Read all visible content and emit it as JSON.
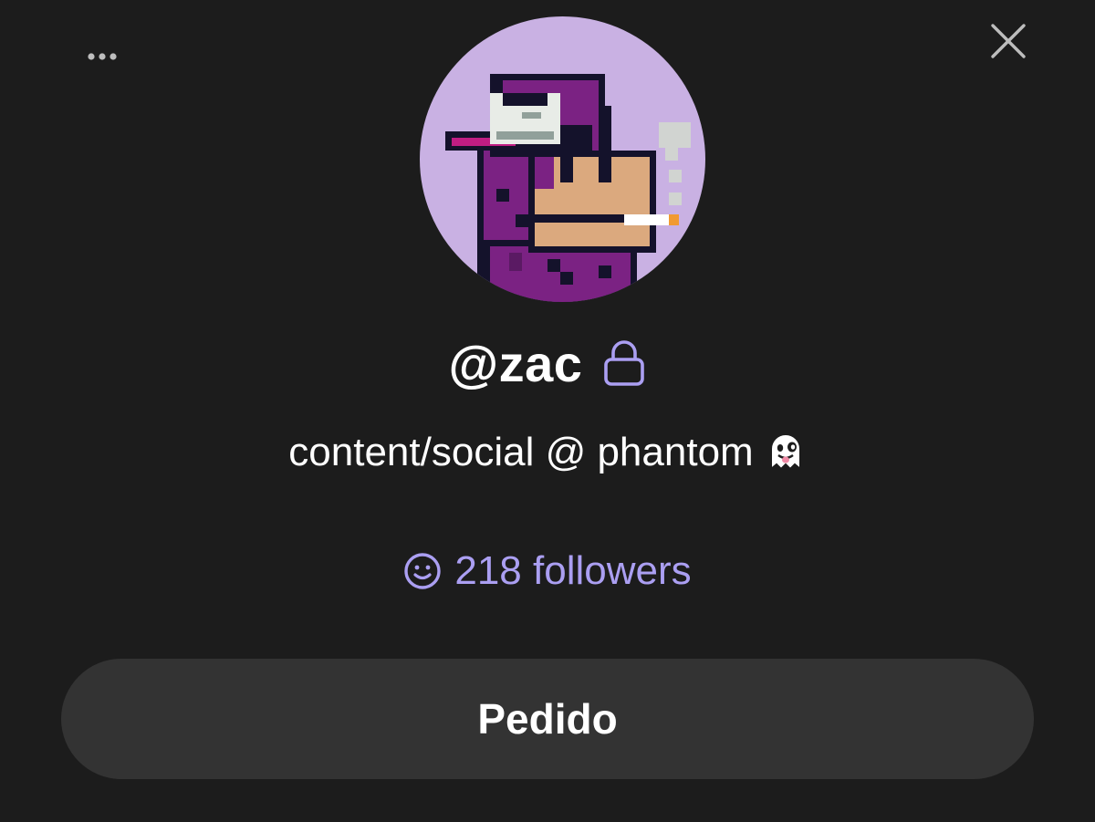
{
  "toolbar": {
    "more_icon": "more-horizontal-icon",
    "close_icon": "close-icon"
  },
  "profile": {
    "avatar_icon": "pixel-avatar",
    "username": "@zac",
    "lock_icon": "lock-icon",
    "bio": "content/social @ phantom",
    "bio_emoji_icon": "ghost-emoji-icon",
    "followers_icon": "smiley-icon",
    "followers": "218 followers"
  },
  "action": {
    "button_label": "Pedido"
  },
  "colors": {
    "background": "#1c1c1c",
    "accent": "#ab9ff2",
    "button": "#333333",
    "avatar_bg": "#c9b1e3"
  }
}
